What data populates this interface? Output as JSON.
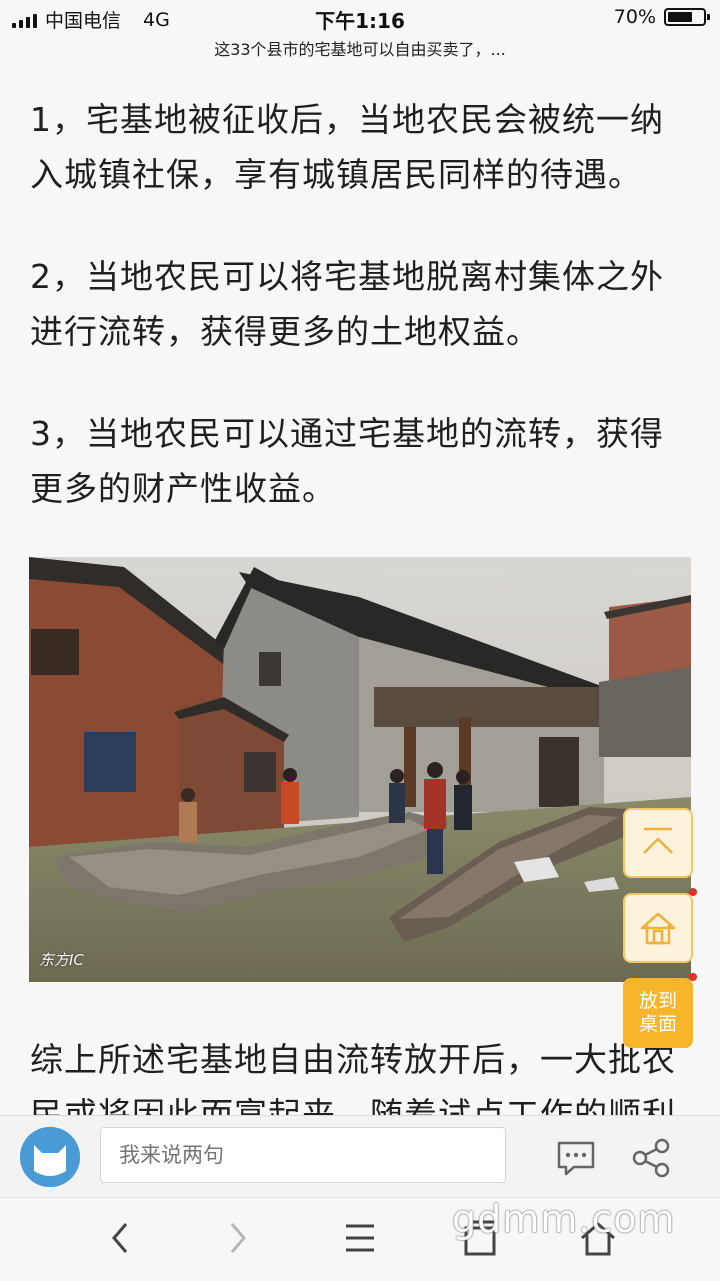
{
  "status_bar": {
    "carrier": "中国电信",
    "network": "4G",
    "time": "下午1:16",
    "battery_percent": "70%",
    "battery_level": 0.7
  },
  "page": {
    "subtitle": "这33个县市的宅基地可以自由买卖了，..."
  },
  "article": {
    "paragraphs": [
      "1，宅基地被征收后，当地农民会被统一纳入城镇社保，享有城镇居民同样的待遇。",
      "2，当地农民可以将宅基地脱离村集体之外进行流转，获得更多的土地权益。",
      "3，当地农民可以通过宅基地的流转，获得更多的财产性收益。"
    ],
    "image_watermark": "东方IC",
    "last_paragraph": "综上所述宅基地自由流转放开后，一大批农民或将因此而富起来，随着试点工作的顺利"
  },
  "float_buttons": {
    "top_icon": "back-to-top-icon",
    "home_icon": "home-icon",
    "desktop_label_line1": "放到",
    "desktop_label_line2": "桌面"
  },
  "comment_bar": {
    "placeholder": "我来说两句",
    "comment_icon": "comment-bubble-icon",
    "share_icon": "share-icon"
  },
  "nav_bar": {
    "back_icon": "chevron-left-icon",
    "forward_icon": "chevron-right-icon",
    "menu_icon": "menu-icon",
    "tabs_icon": "tabs-icon",
    "home_icon": "home-icon"
  },
  "watermark": "gdmm.com",
  "colors": {
    "accent": "#f7b52c",
    "accent_light": "#fdf2dc",
    "badge": "#e0312a",
    "background": "#f7f7f7"
  }
}
